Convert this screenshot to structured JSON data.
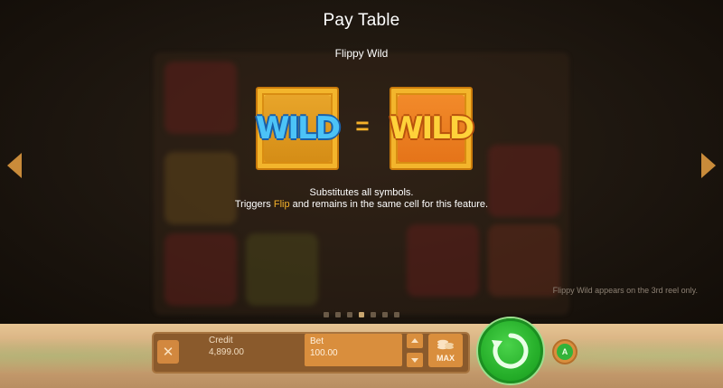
{
  "paytable": {
    "title": "Pay Table",
    "feature_name": "Flippy Wild",
    "symbol_left": "WILD",
    "equals": "=",
    "symbol_right": "WILD",
    "description_line1": "Substitutes all symbols.",
    "description_line2_before": "Triggers",
    "description_line2_highlight": "Flip",
    "description_line2_after": "and remains in the same cell for this feature.",
    "note": "Flippy Wild appears on the 3rd reel only.",
    "page_count": 7,
    "active_page": 4
  },
  "controls": {
    "close_symbol": "✕",
    "credit_label": "Credit",
    "credit_value": "4,899.00",
    "bet_label": "Bet",
    "bet_value": "100.00",
    "max_label": "MAX",
    "auto_label": "A"
  },
  "colors": {
    "accent": "#f5b12a",
    "spin_green": "#27b02b",
    "button_orange": "#d98e3d"
  },
  "icons": [
    "arrow-left-icon",
    "arrow-right-icon",
    "close-icon",
    "chevron-up-icon",
    "chevron-down-icon",
    "coins-icon",
    "spin-icon",
    "autoplay-icon"
  ]
}
